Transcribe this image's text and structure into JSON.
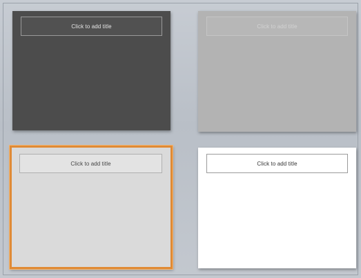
{
  "slides": [
    {
      "title_placeholder": "Click to add title",
      "theme": "dark",
      "background": "#4c4c4c"
    },
    {
      "title_placeholder": "Click to add title",
      "theme": "gray",
      "background": "#b3b3b3"
    },
    {
      "title_placeholder": "Click to add title",
      "theme": "light",
      "background": "#dadada",
      "selected": true
    },
    {
      "title_placeholder": "Click to add title",
      "theme": "white",
      "background": "#ffffff"
    }
  ],
  "accent_color": "#e08a35"
}
